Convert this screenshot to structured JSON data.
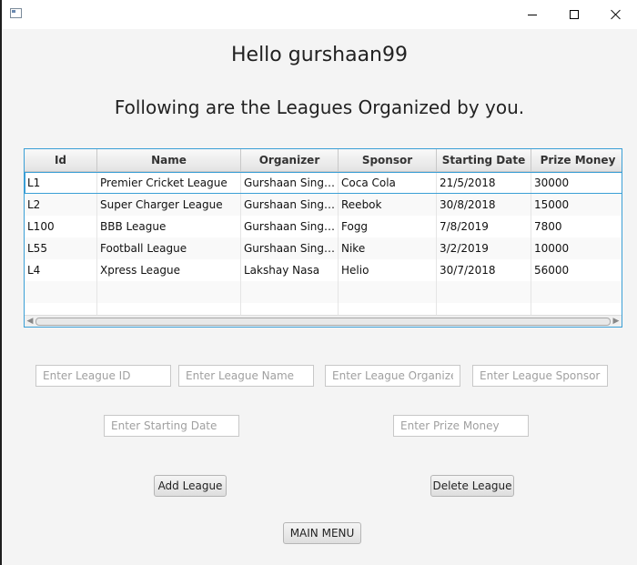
{
  "greeting": "Hello gurshaan99",
  "subtitle": "Following are the Leagues Organized by you.",
  "table": {
    "columns": [
      "Id",
      "Name",
      "Organizer",
      "Sponsor",
      "Starting Date",
      "Prize Money"
    ],
    "rows": [
      [
        "L1",
        "Premier Cricket League",
        "Gurshaan Singh ...",
        "Coca Cola",
        "21/5/2018",
        "30000"
      ],
      [
        "L2",
        "Super Charger League",
        "Gurshaan Singh ...",
        "Reebok",
        "30/8/2018",
        "15000"
      ],
      [
        "L100",
        "BBB League",
        "Gurshaan Singh ...",
        "Fogg",
        "7/8/2019",
        "7800"
      ],
      [
        "L55",
        "Football League",
        "Gurshaan Singh ...",
        "Nike",
        "3/2/2019",
        "10000"
      ],
      [
        "L4",
        "Xpress League",
        "Lakshay Nasa",
        "Helio",
        "30/7/2018",
        "56000"
      ]
    ],
    "selected_row": 0
  },
  "form": {
    "league_id_placeholder": "Enter League ID",
    "league_name_placeholder": "Enter League Name",
    "league_organizer_placeholder": "Enter League Organizer",
    "league_sponsor_placeholder": "Enter League Sponsor",
    "starting_date_placeholder": "Enter Starting Date",
    "prize_money_placeholder": "Enter Prize Money"
  },
  "buttons": {
    "add": "Add League",
    "delete": "Delete League",
    "main_menu": "MAIN MENU"
  }
}
